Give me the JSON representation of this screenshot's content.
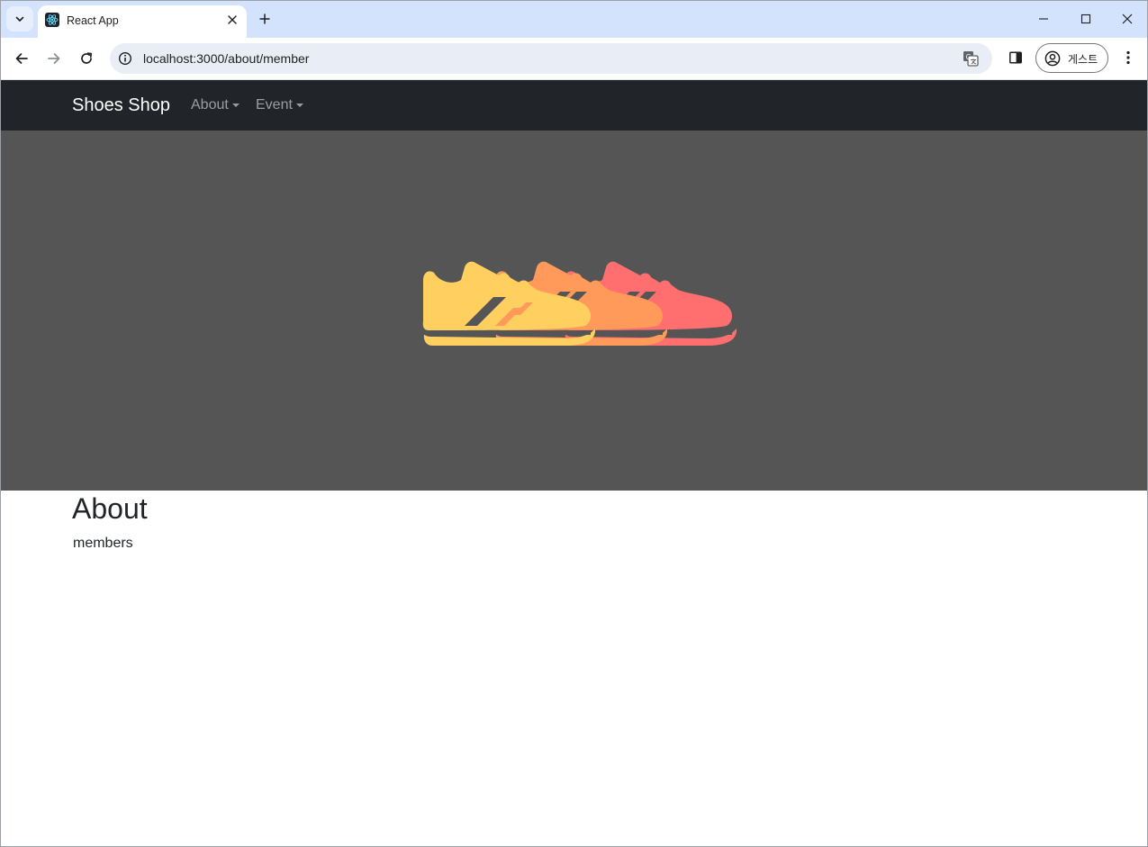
{
  "browser": {
    "tab": {
      "title": "React App",
      "favicon": "react-icon"
    },
    "address": {
      "url": "localhost:3000/about/member"
    },
    "profile": {
      "label": "게스트"
    }
  },
  "site": {
    "brand": "Shoes Shop",
    "nav": [
      {
        "label": "About"
      },
      {
        "label": "Event"
      }
    ],
    "hero": {
      "background": "#555555",
      "image": "shoes-illustration",
      "colors": [
        "#ffd060",
        "#ff9a5a",
        "#ff6f6f"
      ]
    }
  },
  "content": {
    "title": "About",
    "subtitle": "members"
  }
}
